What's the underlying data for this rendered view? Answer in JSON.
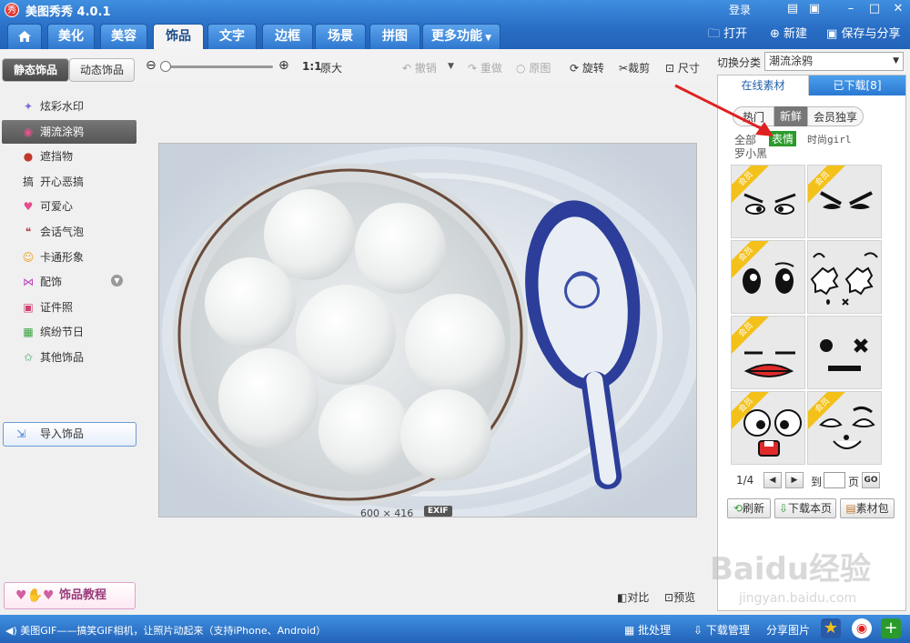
{
  "window": {
    "title": "美图秀秀 4.0.1",
    "logo_char": "秀",
    "login": "登录"
  },
  "nav": {
    "tabs": [
      "美化",
      "美容",
      "饰品",
      "文字",
      "边框",
      "场景",
      "拼图",
      "更多功能"
    ],
    "active": "饰品",
    "actions": {
      "open": "打开",
      "new": "新建",
      "save": "保存与分享"
    }
  },
  "toolbar": {
    "ratio": "1:1",
    "original_size": "原大",
    "undo": "撤销",
    "redo": "重做",
    "original": "原图",
    "rotate": "旋转",
    "crop": "裁剪",
    "size": "尺寸"
  },
  "left": {
    "tabs": [
      "静态饰品",
      "动态饰品"
    ],
    "categories": [
      {
        "label": "炫彩水印",
        "icon": "sparkle-icon",
        "color": "#7a6cd6"
      },
      {
        "label": "潮流涂鸦",
        "icon": "lips-icon",
        "color": "#e8508a"
      },
      {
        "label": "遮挡物",
        "icon": "mask-icon",
        "color": "#c0392b"
      },
      {
        "label": "开心恶搞",
        "icon": "prank-icon",
        "color": "#333333"
      },
      {
        "label": "可爱心",
        "icon": "heart-icon",
        "color": "#e84a8c"
      },
      {
        "label": "会话气泡",
        "icon": "bubble-icon",
        "color": "#c04040"
      },
      {
        "label": "卡通形象",
        "icon": "cartoon-icon",
        "color": "#e8a020"
      },
      {
        "label": "配饰",
        "icon": "bow-icon",
        "color": "#c040c0"
      },
      {
        "label": "证件照",
        "icon": "id-photo-icon",
        "color": "#d04070"
      },
      {
        "label": "缤纷节日",
        "icon": "gift-icon",
        "color": "#3aa040"
      },
      {
        "label": "其他饰品",
        "icon": "star-icon",
        "color": "#3aa060"
      }
    ],
    "active_category": "潮流涂鸦",
    "import_button": "导入饰品",
    "tutorial_button": "饰品教程"
  },
  "canvas": {
    "width": "600",
    "times": "×",
    "height": "416",
    "exif": "EXIF",
    "compare": "对比",
    "preview": "预览"
  },
  "right": {
    "switch_label": "切换分类",
    "switch_value": "潮流涂鸦",
    "tabs": [
      "在线素材",
      "已下载[8]"
    ],
    "filters": [
      "热门",
      "新鲜",
      "会员独享"
    ],
    "active_filter": "新鲜",
    "subcats": [
      "全部",
      "表情",
      "时尚girl",
      "罗小黑"
    ],
    "active_subcat": "表情",
    "badge": "会员",
    "page": "1/4",
    "goto": "到",
    "page_unit": "页",
    "go": "GO",
    "buttons": {
      "refresh": "刷新",
      "download": "下载本页",
      "package": "素材包"
    }
  },
  "status": {
    "message": "美图GIF——搞笑GIF相机，让照片动起来（支持iPhone、Android）",
    "batch": "批处理",
    "download_mgr": "下载管理",
    "share": "分享图片"
  },
  "watermark": {
    "main": "Baidu经验",
    "sub": "jingyan.baidu.com"
  },
  "colors": {
    "accent": "#2a6fc6",
    "active_tag": "#2a9a2a",
    "annotation": "#e02020",
    "badge": "#f3c11a"
  }
}
